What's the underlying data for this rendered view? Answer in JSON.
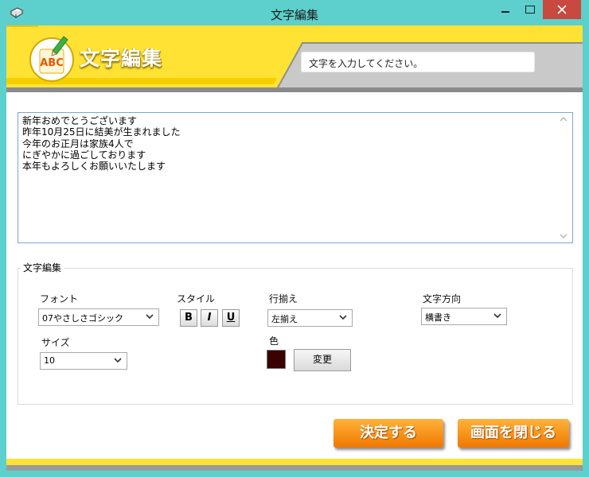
{
  "window": {
    "title": "文字編集",
    "frame_color": "#5dcfcc",
    "close_color": "#c9483f",
    "icons": {
      "app": "notebook-icon",
      "minimize": "minimize-icon",
      "maximize": "maximize-icon",
      "close": "close-icon"
    }
  },
  "banner": {
    "title": "文字編集",
    "logo_text": "ABC",
    "logo_icon": "pencil-abc-icon",
    "hint": "文字を入力してください。",
    "color": "#ffe233"
  },
  "editor": {
    "lines": "新年おめでとうございます\n昨年10月25日に結美が生まれました\n今年のお正月は家族4人で\nにぎやかに過ごしております\n本年もよろしくお願いいたします"
  },
  "settings": {
    "group_label": "文字編集",
    "font_label": "フォント",
    "font_value": "07やさしさゴシック",
    "style_label": "スタイル",
    "bold_label": "B",
    "italic_label": "I",
    "underline_label": "U",
    "align_label": "行揃え",
    "align_value": "左揃え",
    "direction_label": "文字方向",
    "direction_value": "横書き",
    "size_label": "サイズ",
    "size_value": "10",
    "color_label": "色",
    "color_value": "#3a0200",
    "change_label": "変更"
  },
  "actions": {
    "ok_label": "決定する",
    "close_label": "画面を閉じる",
    "accent": "#f07800"
  }
}
